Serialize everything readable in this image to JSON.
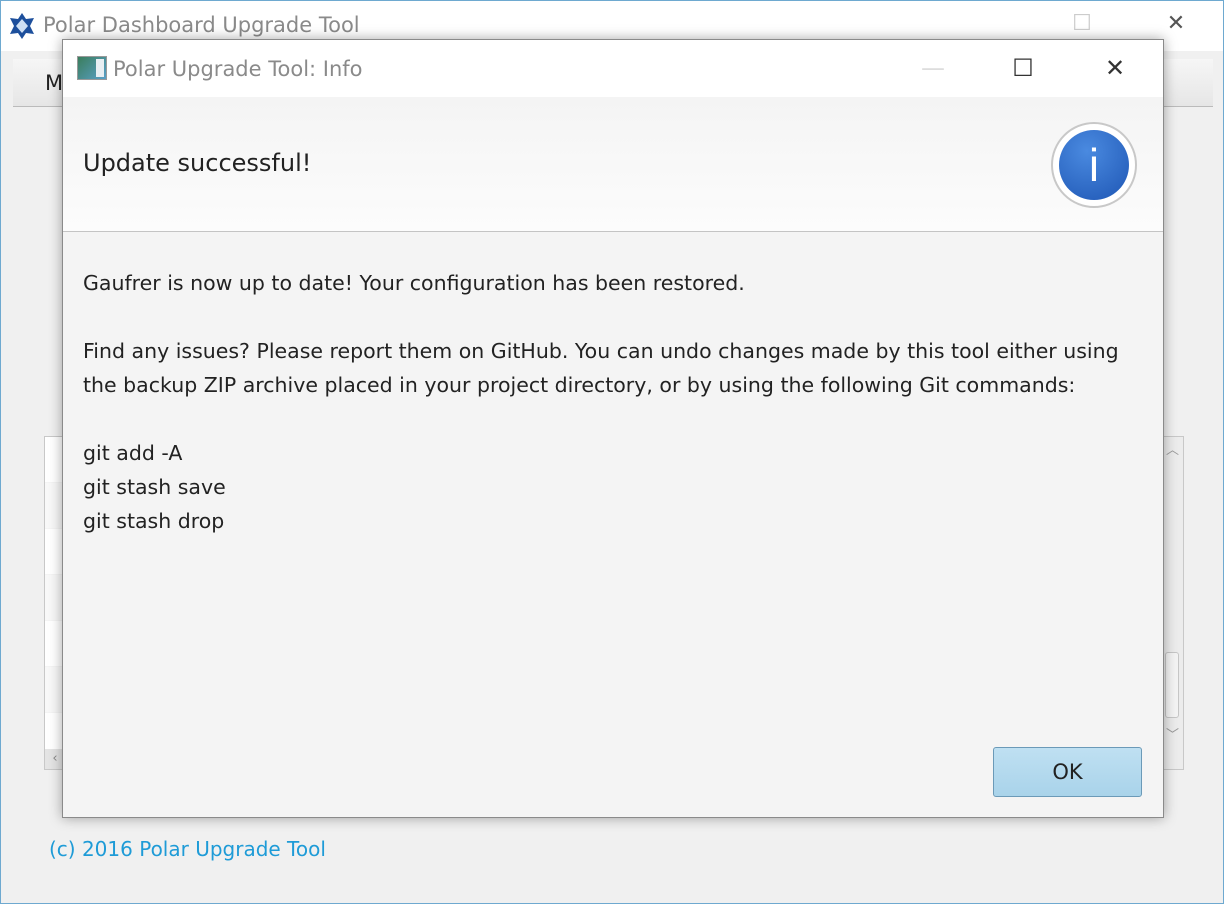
{
  "main_window": {
    "title": "Polar Dashboard Upgrade Tool",
    "menu_first_letter": "M",
    "footer": "(c) 2016 Polar Upgrade Tool"
  },
  "dialog": {
    "title": "Polar Upgrade Tool: Info",
    "heading": "Update successful!",
    "message_1": "Gaufrer is now up to date! Your configuration has been restored.",
    "message_2": "Find any issues? Please report them on GitHub. You can undo changes made by this tool either using the backup ZIP archive placed in your project directory, or by using the following Git commands:",
    "commands": [
      "git add -A",
      "git stash save",
      "git stash drop"
    ],
    "ok_label": "OK",
    "icon": "info-icon"
  },
  "colors": {
    "accent": "#1e9bd7",
    "info": "#2a64c4",
    "ok_button": "#b4d9ee"
  }
}
